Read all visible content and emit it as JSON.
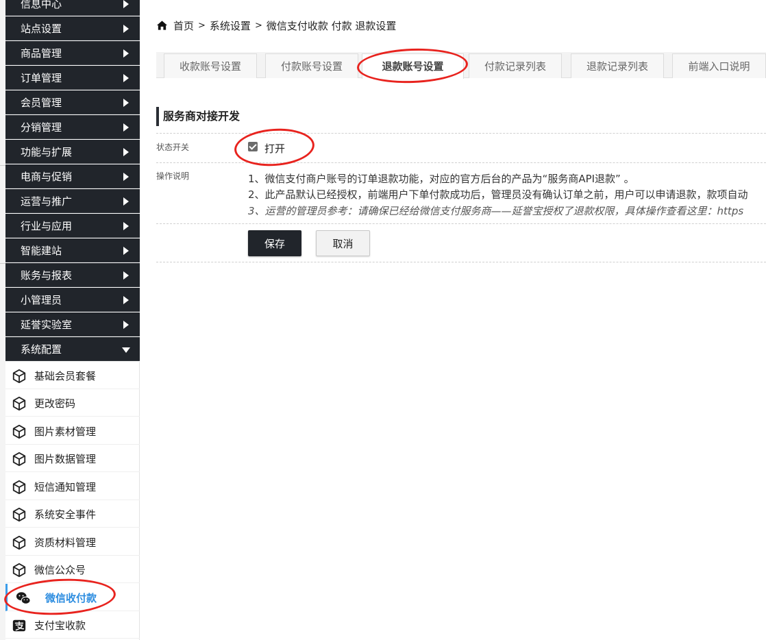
{
  "sidebar": {
    "menu": [
      {
        "label": "信息中心",
        "expanded": false
      },
      {
        "label": "站点设置",
        "expanded": false
      },
      {
        "label": "商品管理",
        "expanded": false
      },
      {
        "label": "订单管理",
        "expanded": false
      },
      {
        "label": "会员管理",
        "expanded": false
      },
      {
        "label": "分销管理",
        "expanded": false
      },
      {
        "label": "功能与扩展",
        "expanded": false
      },
      {
        "label": "电商与促销",
        "expanded": false
      },
      {
        "label": "运营与推广",
        "expanded": false
      },
      {
        "label": "行业与应用",
        "expanded": false
      },
      {
        "label": "智能建站",
        "expanded": false
      },
      {
        "label": "账务与报表",
        "expanded": false
      },
      {
        "label": "小管理员",
        "expanded": false
      },
      {
        "label": "延誉实验室",
        "expanded": false
      },
      {
        "label": "系统配置",
        "expanded": true
      }
    ],
    "submenu": [
      {
        "label": "基础会员套餐",
        "icon": "cube-icon"
      },
      {
        "label": "更改密码",
        "icon": "cube-icon"
      },
      {
        "label": "图片素材管理",
        "icon": "cube-icon"
      },
      {
        "label": "图片数据管理",
        "icon": "cube-icon"
      },
      {
        "label": "短信通知管理",
        "icon": "cube-icon"
      },
      {
        "label": "系统安全事件",
        "icon": "cube-icon"
      },
      {
        "label": "资质材料管理",
        "icon": "cube-icon"
      },
      {
        "label": "微信公众号",
        "icon": "cube-icon"
      },
      {
        "label": "微信收付款",
        "icon": "wechat-icon",
        "active": true
      },
      {
        "label": "支付宝收款",
        "icon": "alipay-icon"
      }
    ]
  },
  "breadcrumb": {
    "home": "首页",
    "sep": ">",
    "level1": "系统设置",
    "current": "微信支付收款 付款 退款设置"
  },
  "tabs": [
    {
      "label": "收款账号设置"
    },
    {
      "label": "付款账号设置"
    },
    {
      "label": "退款账号设置",
      "active": true
    },
    {
      "label": "付款记录列表"
    },
    {
      "label": "退款记录列表"
    },
    {
      "label": "前端入口说明"
    }
  ],
  "form": {
    "section_title": "服务商对接开发",
    "status_label": "状态开关",
    "status_checked": true,
    "status_option": "打开",
    "desc_label": "操作说明",
    "desc_lines": [
      "1、微信支付商户账号的订单退款功能，对应的官方后台的产品为“服务商API退款” 。",
      "2、此产品默认已经授权，前端用户下单付款成功后，管理员没有确认订单之前，用户可以申请退款，款项自动",
      "3、运营的管理员参考：请确保已经给微信支付服务商——延誉宝授权了退款权限，具体操作查看这里：https"
    ],
    "save_label": "保存",
    "cancel_label": "取消"
  },
  "colors": {
    "sidebar_bg": "#21252b",
    "active_blue": "#2d8de0",
    "annotation_red": "#e8231e"
  }
}
